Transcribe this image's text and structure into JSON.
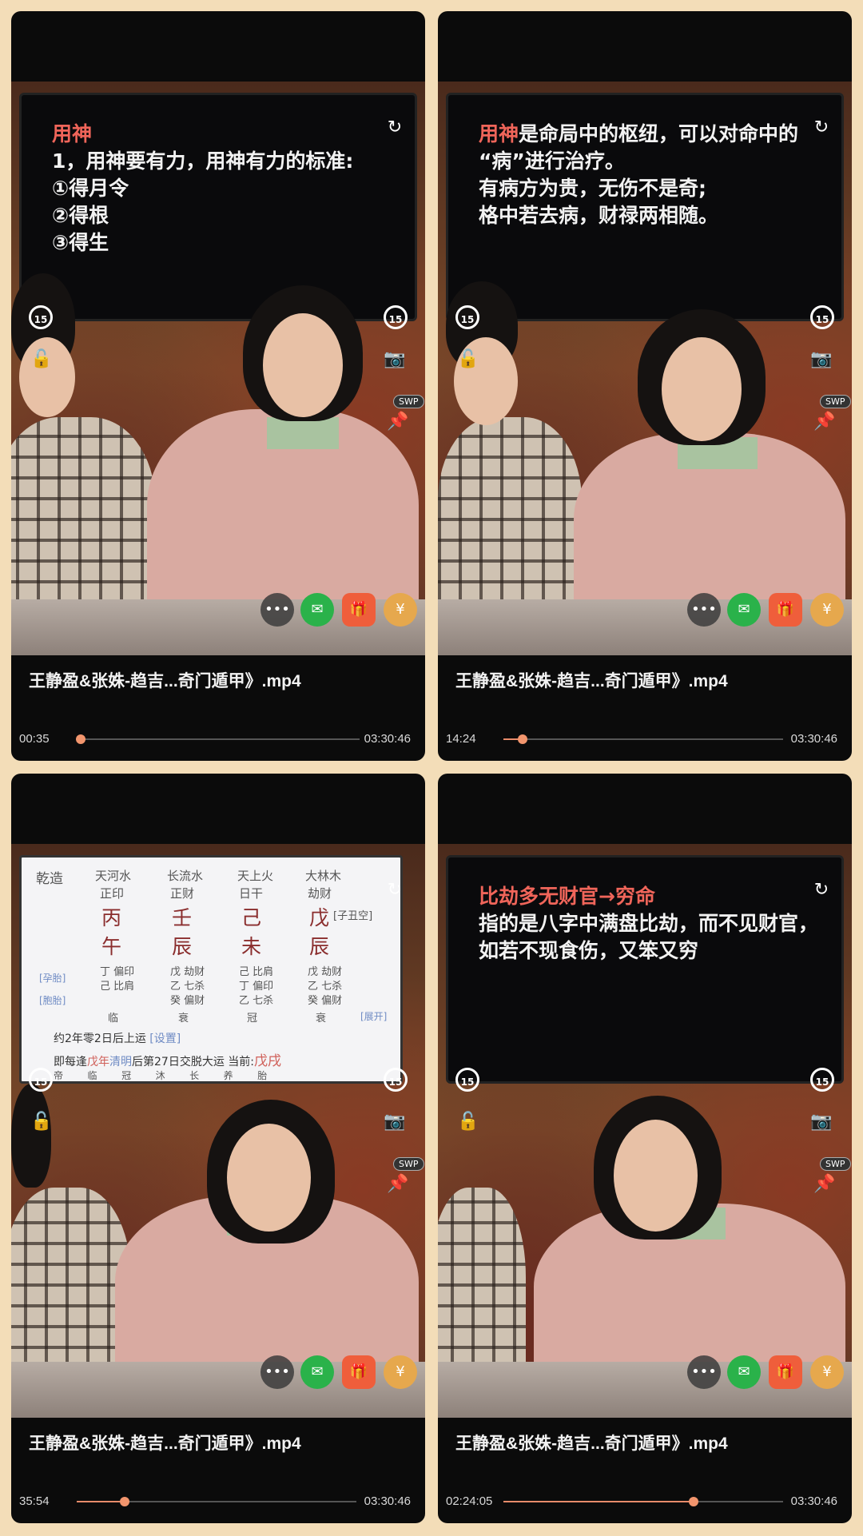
{
  "cards": [
    {
      "screen_type": "text",
      "screen_lines": [
        {
          "red": "用神",
          "rest": ""
        },
        {
          "red": "",
          "rest": "1，用神要有力，用神有力的标准:"
        },
        {
          "red": "",
          "rest": "①得月令"
        },
        {
          "red": "",
          "rest": "②得根"
        },
        {
          "red": "",
          "rest": "③得生"
        }
      ],
      "title": "王静盈&张姝-趋吉...奇门遁甲》.mp4",
      "current_time": "00:35",
      "total_time": "03:30:46",
      "progress": 0.003
    },
    {
      "screen_type": "text",
      "screen_lines": [
        {
          "red": "用神",
          "rest": "是命局中的枢纽，可以对命中的"
        },
        {
          "red": "",
          "rest": "“病”进行治疗。"
        },
        {
          "red": "",
          "rest": "有病方为贵，无伤不是奇;"
        },
        {
          "red": "",
          "rest": "格中若去病，财禄两相随。"
        }
      ],
      "title": "王静盈&张姝-趋吉...奇门遁甲》.mp4",
      "current_time": "14:24",
      "total_time": "03:30:46",
      "progress": 0.068
    },
    {
      "screen_type": "bazi",
      "title": "王静盈&张姝-趋吉...奇门遁甲》.mp4",
      "current_time": "35:54",
      "total_time": "03:30:46",
      "progress": 0.17
    },
    {
      "screen_type": "text",
      "screen_lines": [
        {
          "red": "比劫多无财官→穷命",
          "rest": ""
        },
        {
          "red": "",
          "rest": "指的是八字中满盘比劫，而不见财官，"
        },
        {
          "red": "",
          "rest": "如若不现食伤，又笨又穷"
        }
      ],
      "title": "王静盈&张姝-趋吉...奇门遁甲》.mp4",
      "current_time": "02:24:05",
      "total_time": "03:30:46",
      "progress": 0.68
    }
  ],
  "bazi": {
    "label": "乾造",
    "nayin": [
      "天河水",
      "长流水",
      "天上火",
      "大林木"
    ],
    "shishen": [
      "正印",
      "正财",
      "日干",
      "劫财"
    ],
    "stems": [
      "丙",
      "壬",
      "己",
      "戊"
    ],
    "branches": [
      "午",
      "辰",
      "未",
      "辰"
    ],
    "void": "[子丑空]",
    "hidden": [
      [
        "丁 偏印",
        "己 比肩"
      ],
      [
        "戊 劫财",
        "乙 七杀",
        "癸 偏财"
      ],
      [
        "己 比肩",
        "丁 偏印",
        "乙 七杀"
      ],
      [
        "戊 劫财",
        "乙 七杀",
        "癸 偏财"
      ]
    ],
    "stage": [
      "临",
      "衰",
      "冠",
      "衰"
    ],
    "side_labels": [
      "[孕胎]",
      "[胞胎]",
      "[展开]"
    ],
    "luck_line": "约2年零2日后上运",
    "luck_tag": "[设置]",
    "jiaoyun_pre": "即每逢",
    "jiaoyun_year": "戊年",
    "jiaoyun_term": "清明",
    "jiaoyun_post": "后第27日交脱大运 当前:",
    "current_luck": "戊戌",
    "bottom_row": [
      "帝",
      "临",
      "冠",
      "沐",
      "长",
      "养",
      "胎"
    ]
  },
  "icons": {
    "share": "rotate-arrow-icon",
    "replay_back": "15",
    "replay_forward": "15",
    "lock": "unlock-icon",
    "camera": "camera-icon",
    "swp": "SWP",
    "pin": "pin-icon",
    "more": "•••"
  },
  "colors": {
    "accent_progress": "#f2956d",
    "screen_red": "#f0655a",
    "wechat": "#2ab24a"
  }
}
